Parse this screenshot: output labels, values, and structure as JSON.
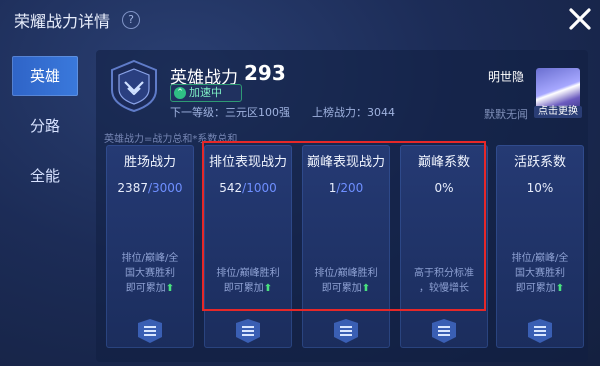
{
  "window": {
    "title": "荣耀战力详情",
    "help_symbol": "?"
  },
  "sidebar": {
    "items": [
      {
        "label": "英雄",
        "active": true
      },
      {
        "label": "分路",
        "active": false
      },
      {
        "label": "全能",
        "active": false
      }
    ]
  },
  "hero": {
    "title": "英雄战力",
    "score": "293",
    "boost_label": "加速中",
    "next_level": "下一等级：三元区100强",
    "rank_power": "上榜战力：3044"
  },
  "player": {
    "name": "明世隐",
    "subtitle": "默默无闻",
    "change_button": "点击更换"
  },
  "formula": "英雄战力=战力总和*系数总和",
  "cards": [
    {
      "title": "胜场战力",
      "value": "2387",
      "max": "/3000",
      "desc_lines": [
        "排位/巅峰/全",
        "国大赛胜利",
        "即可累加"
      ]
    },
    {
      "title": "排位表现战力",
      "value": "542",
      "max": "/1000",
      "desc_lines": [
        "排位/巅峰胜利",
        "即可累加"
      ]
    },
    {
      "title": "巅峰表现战力",
      "value": "1",
      "max": "/200",
      "desc_lines": [
        "排位/巅峰胜利",
        "即可累加"
      ]
    },
    {
      "title": "巅峰系数",
      "value": "0%",
      "max": "",
      "desc_lines": [
        "高于积分标准",
        "，较慢增长"
      ]
    },
    {
      "title": "活跃系数",
      "value": "10%",
      "max": "",
      "desc_lines": [
        "排位/巅峰/全",
        "国大赛胜利",
        "即可累加"
      ]
    }
  ],
  "colors": {
    "accent": "#3a79dc",
    "highlight": "#e62828",
    "boost": "#2fbf84",
    "arrow": "#48e07e"
  }
}
